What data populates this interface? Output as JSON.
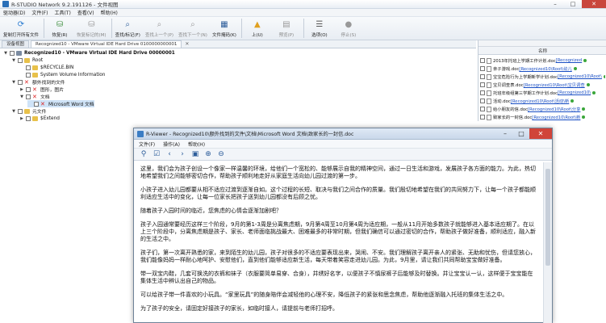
{
  "window": {
    "title": "R-STUDIO Network 9.2.191126 - 文件视图",
    "minimize": "–",
    "maximize": "□",
    "close": "✕"
  },
  "menu": [
    "驱动器(D)",
    "文件(F)",
    "工具(T)",
    "查看(V)",
    "帮助(H)"
  ],
  "toolbar": [
    {
      "label": "复制打开所有文件",
      "icon": "refresh-icon",
      "color": "#2a7bd0"
    },
    {
      "label": "恢复(R)",
      "icon": "recover-icon",
      "color": "#3a8c3a"
    },
    {
      "label": "恢复标记的(M)",
      "icon": "recover-marked-icon",
      "color": "#999999",
      "disabled": true
    },
    {
      "label": "查找/标记(F)",
      "icon": "find-icon",
      "color": "#2d5d9a"
    },
    {
      "label": "查找上一个(P)",
      "icon": "find-prev-icon",
      "color": "#999999",
      "disabled": true
    },
    {
      "label": "查找下一个(N)",
      "icon": "find-next-icon",
      "color": "#999999",
      "disabled": true
    },
    {
      "label": "文件掩码(K)",
      "icon": "mask-icon",
      "color": "#2d5d9a"
    },
    {
      "label": "上(U)",
      "icon": "up-icon",
      "color": "#e0a020"
    },
    {
      "label": "预览(P)",
      "icon": "preview-icon",
      "color": "#999999",
      "disabled": true
    },
    {
      "label": "选项(O)",
      "icon": "options-icon",
      "color": "#555555"
    },
    {
      "label": "停止(S)",
      "icon": "stop-icon",
      "color": "#999999",
      "disabled": true
    }
  ],
  "tabs": [
    {
      "label": "设备视图"
    },
    {
      "label": "Recognized10 - VMware Virtual IDE Hard Drive 0100000000001"
    }
  ],
  "tree": [
    {
      "label": "Recognized10 - VMware Virtual IDE Hard Drive 00000001",
      "exp": "▼",
      "icon": "disk",
      "level": 0,
      "bold": true
    },
    {
      "label": "Root",
      "exp": "▼",
      "icon": "folder",
      "level": 1
    },
    {
      "label": "$RECYCLE.BIN",
      "exp": "",
      "icon": "folder",
      "level": 2
    },
    {
      "label": "System Volume Information",
      "exp": "",
      "icon": "folder",
      "level": 2
    },
    {
      "label": "额外找到的文件",
      "exp": "▼",
      "icon": "x",
      "level": 1
    },
    {
      "label": "图形，图片",
      "exp": "▶",
      "icon": "x",
      "level": 2
    },
    {
      "label": "文档",
      "exp": "▼",
      "icon": "x",
      "level": 2
    },
    {
      "label": "Microsoft Word 文档",
      "exp": "",
      "icon": "x",
      "level": 3
    },
    {
      "label": "元文件",
      "exp": "▼",
      "icon": "folder",
      "level": 1
    },
    {
      "label": "$Extend",
      "exp": "▶",
      "icon": "folder",
      "level": 2
    }
  ],
  "right_pane": {
    "header": "名称",
    "rows": [
      {
        "name": "2013年托班上学期工作计划.doc",
        "path": "[Recognized"
      },
      {
        "name": "亲子游戏.doc",
        "path": "[Recognized10\\Root\\幼儿"
      },
      {
        "name": "宝宝危险行为上学期新学计划.doc",
        "path": "[Recognized10\\Root\\"
      },
      {
        "name": "宝贝调查表.doc",
        "path": "[Recognized10\\Root\\宝贝调查"
      },
      {
        "name": "托班年级组第三学期工作计划.doc",
        "path": "[Recognized10\\"
      },
      {
        "name": "活动.doc",
        "path": "[Recognized10\\Root\\活动\\新"
      },
      {
        "name": "给小朋友的信.doc",
        "path": "[Recognized10\\Root\\分享"
      },
      {
        "name": "致家长的一封信.doc",
        "path": "[Recognized10\\Root\\新"
      }
    ]
  },
  "viewer": {
    "title": "R-Viewer - Recognized10\\额外找到的文件\\文档\\Microsoft Word 文档\\致家长的一封信.doc",
    "minimize": "–",
    "maximize": "□",
    "close": "✕",
    "menu": [
      "文件(F)",
      "操作(A)",
      "帮助(H)"
    ],
    "tools": [
      "filter-icon",
      "checkmark-icon",
      "arrow-left-icon",
      "arrow-right-icon",
      "image-icon",
      "zoom-in-icon",
      "zoom-out-icon"
    ],
    "paragraphs": [
      "这里，我们会为孩子创设一个像家一样温馨的环境，给他们一个宽松的、能够展示自我的精神空间，通过一日生活和游戏，发展孩子各方面的能力。为此，热切地希望我们之间能够密切合作，帮助孩子顺利地走好从家庭生活向幼儿园过渡的第一步。",
      "小孩子进入幼儿园都要从相不适应过渡到逐渐自如。这个过程的长短、取决与我们之间合作的质量。我们殷切地希望在我们的共同努力下，让每一个孩子都能顺利适应生活中的变化，让每一位家长把孩子送到幼儿园都没有后顾之忧。",
      "随着孩子入园时间的临近，您焦虑的心情会逐渐加剧吧？",
      "孩子入园通常要经历这样三个阶段，9月的第1-3周是分离焦虑期，9月第4周至10月第4周为适应期，一般从11月开始多数孩子就能够进入基本适应期了。在以上三个阶段中，分离焦虑期是孩子、家长、老师面临挑战最大、困难最多的非常时期，但我们确信可以通过密切的合作，帮助孩子做好准备，顺利适应，融入新的生活之中。",
      "孩子们，第一次离开熟悉的家，来到陌生的幼儿园，孩子对很多的不适应要表现出来，哭闹、不安。我们理解孩子离开亲人的紧张、无助和忧伤，但请您放心，我们能像妈妈一样耐心地呵护、安慰他们，直到他们能够适应新生活，每天带着笑容走进幼儿园。为此，9月里，请让我们共同帮助宝宝做好准备。",
      "带一双宝内鞋，几套可换洗的衣裤和袜子（衣服要简单易穿、合身），并绣好名字，以便孩子不慎尿裤子后能够及时替换。并让宝宝认一认，这样便于宝宝能在集体生活中辨认出自己的物品。",
      "可以给孩子带一件喜欢的小玩具。“家里玩具”的随身陪伴会减轻他的心理不安，降低孩子的紧张和思念焦虑，帮助他逐渐融入托班的集体生活之中。",
      "为了孩子的安全，请固定好接孩子的家长，如临时接人，请提前与老师打招呼。"
    ]
  }
}
